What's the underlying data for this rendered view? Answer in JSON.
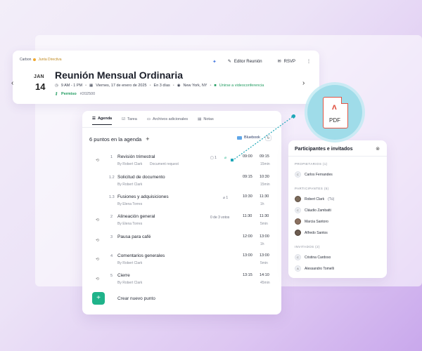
{
  "header": {
    "org": "Carbon",
    "sub_org": "Junta Directiva",
    "ai_label": "",
    "editor_label": "Editor Reunión",
    "rsvp_label": "RSVP",
    "more_label": "⋮",
    "date_month": "JAN",
    "date_day": "14",
    "title": "Reunión Mensual Ordinaria",
    "time": "9 AM - 1 PM",
    "date_full": "Viernes, 17 de enero de 2025",
    "relative": "En 3 días",
    "location": "New York, NY",
    "mode": "Unirse a videoconferencia",
    "permission": "Permiso",
    "code": "#202500"
  },
  "tabs": [
    {
      "label": "Agenda"
    },
    {
      "label": "Tarea"
    },
    {
      "label": "Archivos adicionales"
    },
    {
      "label": "Notas"
    }
  ],
  "agenda": {
    "count_label": "6 puntos en la agenda",
    "bluebook_label": "Bluebook",
    "items": [
      {
        "num": "1",
        "title": "Revisión trimestral",
        "by": "By Robert Clark",
        "extra": "Document request",
        "count": "1",
        "start": "09:00",
        "end": "09:15",
        "dur": "15min"
      },
      {
        "num": "1.2",
        "title": "Solicitud de documento",
        "by": "By Robert Clark",
        "extra": "",
        "count": "",
        "start": "09:15",
        "end": "10:30",
        "dur": "15min"
      },
      {
        "num": "1.3",
        "title": "Fusiones y adquisiciones",
        "by": "By Elena Torres",
        "extra": "",
        "count": "1",
        "start": "10:30",
        "end": "11:30",
        "dur": "1h"
      },
      {
        "num": "2",
        "title": "Alineación general",
        "by": "By Elena Torres",
        "extra": "0 de 3 votos",
        "count": "",
        "start": "11:30",
        "end": "11:30",
        "dur": "5min"
      },
      {
        "num": "3",
        "title": "Pausa para café",
        "by": "",
        "extra": "",
        "count": "",
        "start": "12:00",
        "end": "13:00",
        "dur": "1h"
      },
      {
        "num": "4",
        "title": "Comentarios generales",
        "by": "By Robert Clark",
        "extra": "",
        "count": "",
        "start": "13:00",
        "end": "13:00",
        "dur": "5min"
      },
      {
        "num": "5",
        "title": "Cierre",
        "by": "By Robert Clark",
        "extra": "",
        "count": "",
        "start": "13:15",
        "end": "14:10",
        "dur": "45min"
      }
    ],
    "create_label": "Crear nuevo punto"
  },
  "participants": {
    "title": "Participantes e invitados",
    "groups": [
      {
        "label": "PROPIETARIOS (1)",
        "people": [
          {
            "name": "Carlos Fernandes",
            "tag": ""
          }
        ]
      },
      {
        "label": "PARTICIPANTES (5)",
        "people": [
          {
            "name": "Robert Clark",
            "tag": "(Tú)"
          },
          {
            "name": "Cláudio Zambatti",
            "tag": ""
          },
          {
            "name": "Marcia Santoro",
            "tag": ""
          },
          {
            "name": "Alfredo Santos",
            "tag": ""
          }
        ]
      },
      {
        "label": "INVITADOS (2)",
        "people": [
          {
            "name": "Cristina Cardoso",
            "tag": ""
          },
          {
            "name": "Alessandro Tomelli",
            "tag": ""
          }
        ]
      }
    ]
  },
  "pdf": {
    "label": "PDF"
  },
  "colors": {
    "accent_green": "#1fb38a",
    "pdf_red": "#e05545",
    "bluebook": "#5fa6e8"
  }
}
